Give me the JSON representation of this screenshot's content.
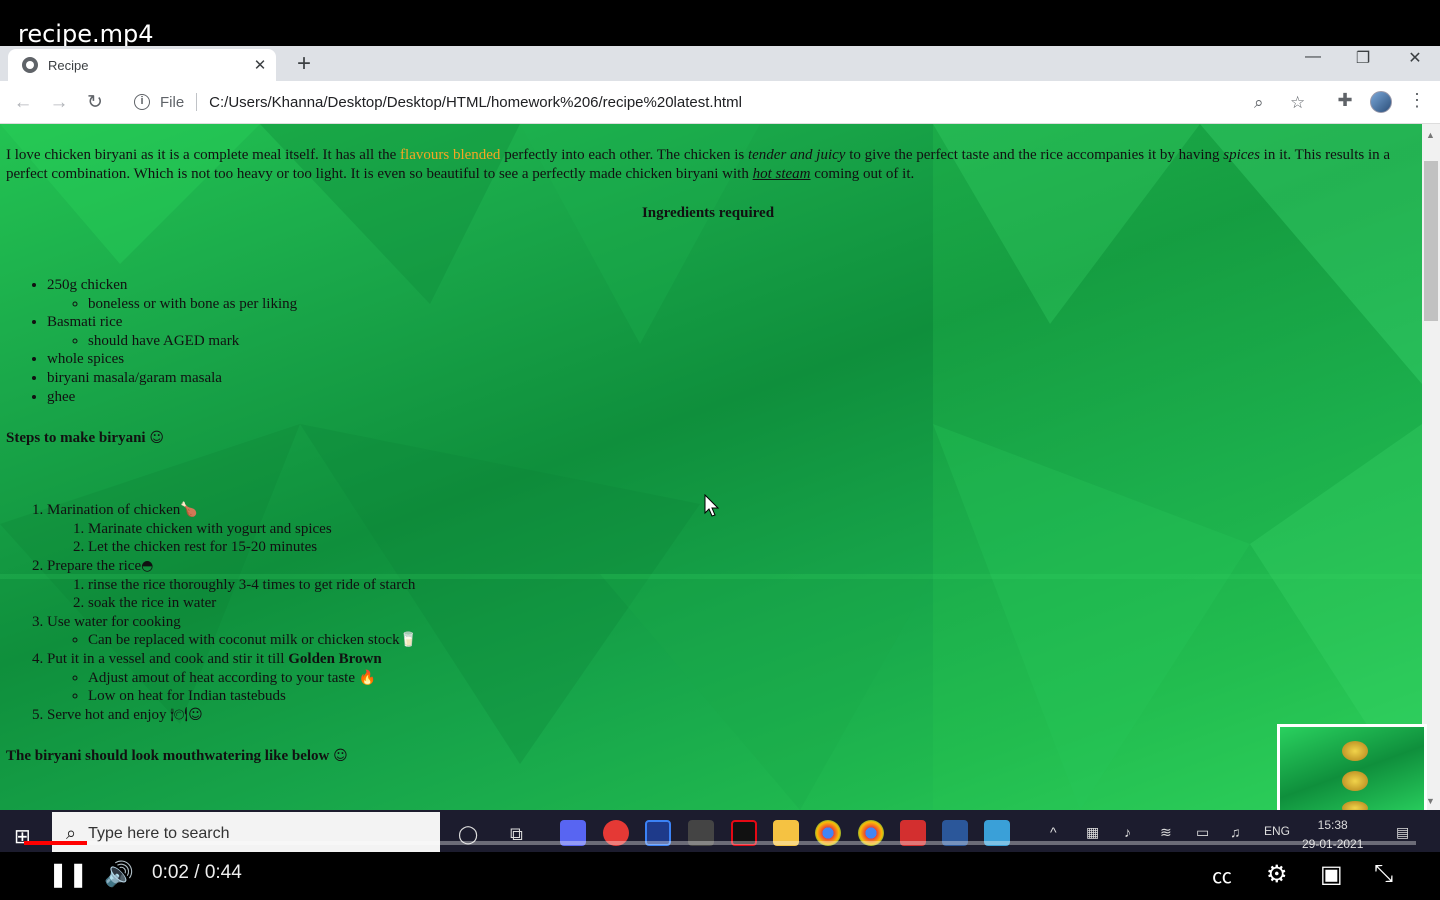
{
  "video": {
    "title": "recipe.mp4",
    "time_current": "0:02",
    "time_total": "0:44",
    "time_sep": " / ",
    "progress_fraction": 0.045
  },
  "browser": {
    "tab_title": "Recipe",
    "file_label": "File",
    "url": "C:/Users/Khanna/Desktop/Desktop/HTML/homework%206/recipe%20latest.html"
  },
  "recipe": {
    "intro_1": "I love chicken biryani as it is a complete meal itself. It has all the ",
    "intro_highlight": "flavours blended",
    "intro_2": " perfectly into each other. The chicken is ",
    "intro_italic1": "tender and juicy",
    "intro_3": " to give the perfect taste and the rice accompanies it by having ",
    "intro_italic2": "spices",
    "intro_4": " in it. This results in a perfect combination. Which is not too heavy or too light. It is even so beautiful to see a perfectly made chicken biryani with ",
    "intro_link": "hot steam",
    "intro_5": " coming out of it.",
    "ingredients_heading": "Ingredients required",
    "ingredients": [
      {
        "label": "250g chicken",
        "sub": "boneless or with bone as per liking"
      },
      {
        "label": "Basmati rice",
        "sub": "should have AGED mark"
      },
      {
        "label": "whole spices"
      },
      {
        "label": "biryani masala/garam masala"
      },
      {
        "label": "ghee"
      }
    ],
    "steps_heading": "Steps to make biryani",
    "steps_emoji": "☺",
    "steps": [
      {
        "label": "Marination of chicken",
        "emoji": "🍗",
        "sub": [
          "Marinate chicken with yogurt and spices",
          "Let the chicken rest for 15-20 minutes"
        ]
      },
      {
        "label": "Prepare the rice",
        "emoji": "◓",
        "sub": [
          "rinse the rice thoroughly 3-4 times to get ride of starch",
          "soak the rice in water"
        ]
      },
      {
        "label": "Use water for cooking",
        "ul_sub": [
          "Can be replaced with coconut milk or chicken stock"
        ],
        "ul_emoji": "🥛"
      },
      {
        "label": "Put it in a vessel and cook and stir it till ",
        "bold": "Golden Brown",
        "ul_sub": [
          "Adjust amout of heat according to your taste",
          "Low on heat for Indian tastebuds"
        ],
        "ul_emoji": "🔥"
      },
      {
        "label": "Serve hot and enjoy",
        "emoji": "🍽☺"
      }
    ],
    "final_heading": "The biryani should look mouthwatering like below",
    "final_emoji": "☺"
  },
  "taskbar": {
    "search_placeholder": "Type here to search",
    "lang": "ENG",
    "time": "15:38",
    "date": "29-01-2021"
  },
  "colors": {
    "page_green": "#1aa84a",
    "highlight": "#f5a623",
    "progress": "#ff0000"
  }
}
